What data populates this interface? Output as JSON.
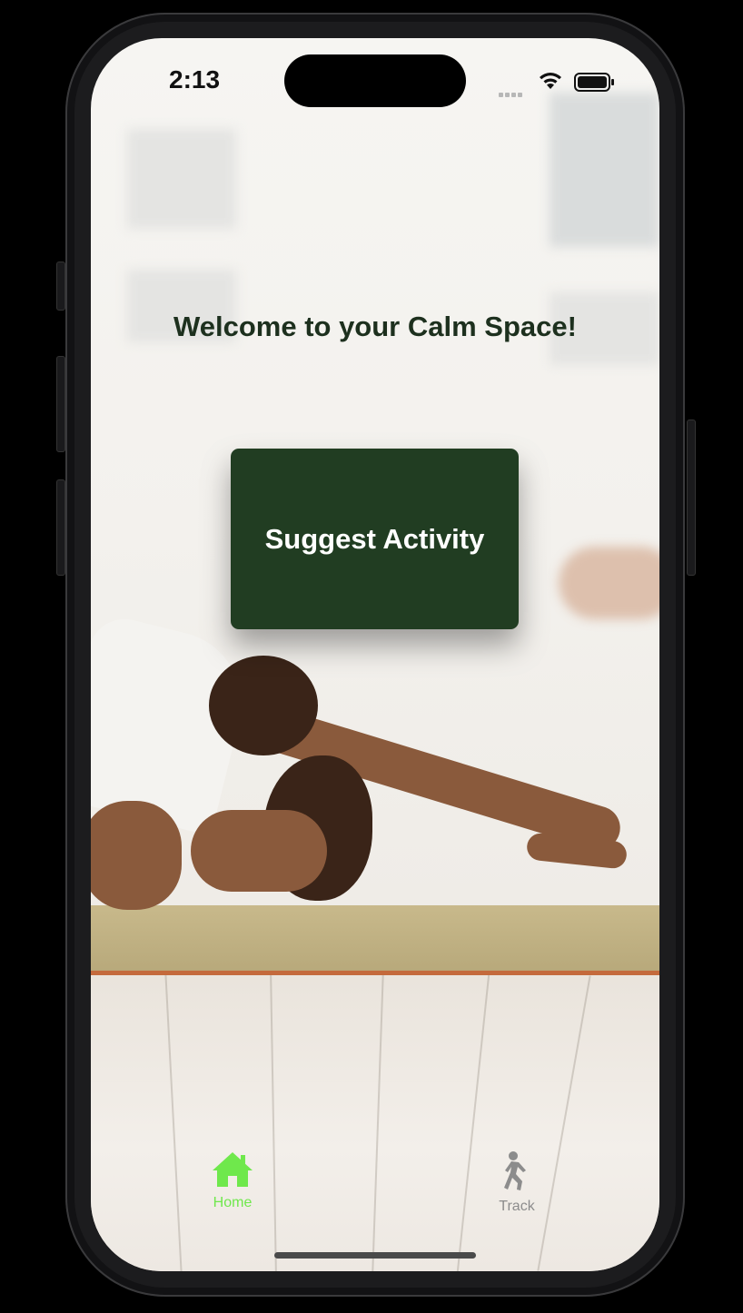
{
  "status_bar": {
    "time": "2:13"
  },
  "main": {
    "welcome_title": "Welcome to your Calm Space!",
    "suggest_button_label": "Suggest Activity",
    "primary_color": "#213d22",
    "text_color": "#1d301e"
  },
  "tab_bar": {
    "tabs": [
      {
        "label": "Home",
        "icon": "house-icon",
        "selected": true,
        "color": "#6fe84c"
      },
      {
        "label": "Track",
        "icon": "walking-figure-icon",
        "selected": false,
        "color": "#8c8c8c"
      }
    ]
  }
}
